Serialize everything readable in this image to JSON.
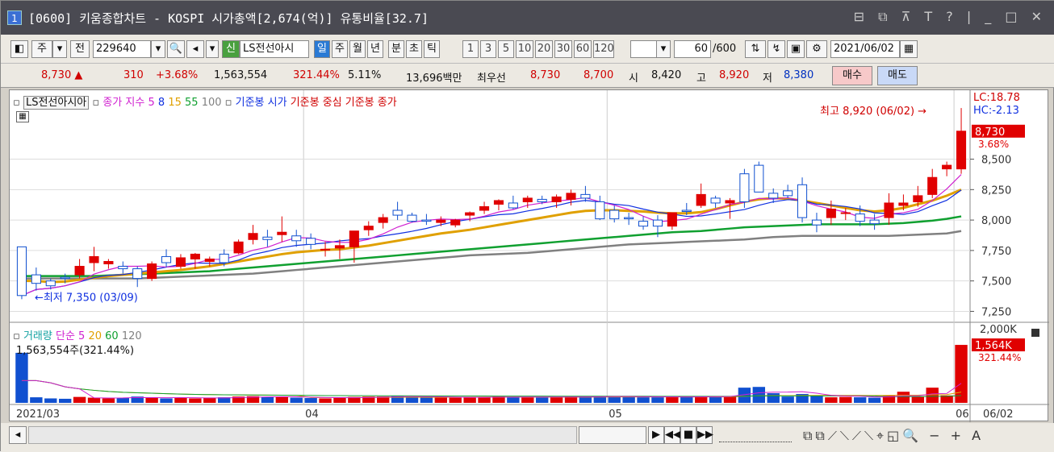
{
  "titlebar": {
    "window_num": "1",
    "title": "[0600] 키움종합차트 - KOSPI 시가총액[2,674(억)] 유통비율[32.7]"
  },
  "toolbar": {
    "market_label": "주",
    "prev_label": "전",
    "code_value": "229640",
    "credit_label": "신",
    "stock_name": "LS전선아시",
    "periods": [
      "일",
      "주",
      "월",
      "년",
      "분",
      "초",
      "틱"
    ],
    "active_period": "일",
    "intervals": [
      "1",
      "3",
      "5",
      "10",
      "20",
      "30",
      "60",
      "120"
    ],
    "count_value": "60",
    "count_total": "/600",
    "date_value": "2021/06/02"
  },
  "quote": {
    "price": "8,730 ▲",
    "change": "310",
    "change_pct": "+3.68%",
    "volume": "1,563,554",
    "volume_pct": "321.44%",
    "turnover": "5.11%",
    "amount": "13,696백만",
    "best_label": "최우선",
    "ask": "8,730",
    "bid": "8,700",
    "open_label": "시",
    "open": "8,420",
    "high_label": "고",
    "high": "8,920",
    "low_label": "저",
    "low": "8,380",
    "buy_label": "매수",
    "sell_label": "매도"
  },
  "price_legend": {
    "name": "LS전선아시아",
    "ma_label": "종가 지수",
    "ma_periods": [
      "5",
      "8",
      "15",
      "55",
      "100"
    ],
    "ma_colors": [
      "#d020d0",
      "#1030e0",
      "#e0a000",
      "#10a030",
      "#808080"
    ],
    "base_open": "기준봉 시가",
    "base_mid": "기준봉 중심",
    "base_close": "기준봉 종가",
    "lc": "LC:18.78",
    "hc": "HC:-2.13"
  },
  "annotations": {
    "high_note": "최고 8,920 (06/02) →",
    "low_note": "←최저 7,350 (03/09)",
    "last_price": "8,730",
    "last_pct": "3.68%"
  },
  "volume_legend": {
    "label": "거래량",
    "ma_label": "단순",
    "ma_periods": [
      "5",
      "20",
      "60",
      "120"
    ],
    "value_text": "1,563,554주(321.44%)",
    "axis_top": "2,000K",
    "last_value": "1,564K",
    "last_pct": "321.44%"
  },
  "x_axis": {
    "labels": [
      "2021/03",
      "04",
      "05",
      "06"
    ],
    "cursor_date": "06/02"
  },
  "chart_data": {
    "type": "candlestick",
    "y_ticks": [
      "8,500",
      "8,250",
      "8,000",
      "7,750",
      "7,500",
      "7,250"
    ],
    "ylim": [
      7200,
      9000
    ],
    "candles": [
      [
        7780,
        7780,
        7350,
        7380
      ],
      [
        7550,
        7610,
        7420,
        7480
      ],
      [
        7500,
        7520,
        7430,
        7460
      ],
      [
        7530,
        7560,
        7480,
        7520
      ],
      [
        7550,
        7680,
        7520,
        7620
      ],
      [
        7650,
        7780,
        7580,
        7700
      ],
      [
        7640,
        7680,
        7600,
        7660
      ],
      [
        7620,
        7660,
        7560,
        7600
      ],
      [
        7600,
        7620,
        7450,
        7520
      ],
      [
        7520,
        7660,
        7500,
        7640
      ],
      [
        7700,
        7760,
        7610,
        7650
      ],
      [
        7620,
        7720,
        7600,
        7690
      ],
      [
        7680,
        7730,
        7600,
        7720
      ],
      [
        7660,
        7700,
        7620,
        7680
      ],
      [
        7720,
        7760,
        7620,
        7650
      ],
      [
        7730,
        7840,
        7720,
        7820
      ],
      [
        7840,
        7960,
        7800,
        7890
      ],
      [
        7860,
        7920,
        7780,
        7840
      ],
      [
        7880,
        8030,
        7820,
        7900
      ],
      [
        7870,
        7920,
        7780,
        7830
      ],
      [
        7850,
        7890,
        7760,
        7800
      ],
      [
        7760,
        7820,
        7700,
        7760
      ],
      [
        7770,
        7840,
        7680,
        7790
      ],
      [
        7780,
        7880,
        7650,
        7910
      ],
      [
        7920,
        7990,
        7870,
        7950
      ],
      [
        7980,
        8050,
        7930,
        8020
      ],
      [
        8080,
        8150,
        8000,
        8040
      ],
      [
        8040,
        8060,
        7980,
        7990
      ],
      [
        8000,
        8050,
        7960,
        7990
      ],
      [
        7980,
        8030,
        7950,
        8000
      ],
      [
        7960,
        8010,
        7940,
        8000
      ],
      [
        8040,
        8070,
        7990,
        8060
      ],
      [
        8080,
        8150,
        8050,
        8110
      ],
      [
        8130,
        8170,
        8080,
        8160
      ],
      [
        8140,
        8200,
        8090,
        8100
      ],
      [
        8150,
        8200,
        8100,
        8180
      ],
      [
        8170,
        8200,
        8130,
        8150
      ],
      [
        8150,
        8210,
        8100,
        8190
      ],
      [
        8170,
        8250,
        8120,
        8220
      ],
      [
        8210,
        8280,
        8150,
        8180
      ],
      [
        8150,
        8200,
        8000,
        8010
      ],
      [
        8080,
        8120,
        7980,
        8010
      ],
      [
        8020,
        8060,
        7960,
        8010
      ],
      [
        7990,
        8030,
        7920,
        7950
      ],
      [
        8000,
        8040,
        7860,
        7950
      ],
      [
        7950,
        8060,
        7920,
        8060
      ],
      [
        8080,
        8140,
        8040,
        8070
      ],
      [
        8120,
        8300,
        8100,
        8210
      ],
      [
        8180,
        8200,
        8100,
        8140
      ],
      [
        8140,
        8180,
        8010,
        8160
      ],
      [
        8380,
        8420,
        8100,
        8150
      ],
      [
        8450,
        8480,
        8250,
        8230
      ],
      [
        8220,
        8260,
        8140,
        8180
      ],
      [
        8240,
        8290,
        8180,
        8200
      ],
      [
        8290,
        8350,
        7980,
        8020
      ],
      [
        8000,
        8060,
        7900,
        7960
      ],
      [
        8020,
        8160,
        7960,
        8090
      ],
      [
        8060,
        8100,
        8000,
        8060
      ],
      [
        8050,
        8120,
        7950,
        7990
      ],
      [
        8000,
        8050,
        7920,
        7970
      ],
      [
        8020,
        8220,
        7960,
        8140
      ],
      [
        8120,
        8210,
        8080,
        8140
      ],
      [
        8150,
        8280,
        8110,
        8200
      ],
      [
        8210,
        8420,
        8180,
        8350
      ],
      [
        8420,
        8480,
        8360,
        8450
      ],
      [
        8420,
        8920,
        8380,
        8730
      ]
    ],
    "ma15": [
      7500,
      7500,
      7490,
      7495,
      7510,
      7525,
      7540,
      7550,
      7560,
      7570,
      7580,
      7590,
      7605,
      7620,
      7640,
      7660,
      7680,
      7700,
      7720,
      7735,
      7745,
      7755,
      7760,
      7775,
      7790,
      7810,
      7830,
      7850,
      7870,
      7890,
      7905,
      7920,
      7940,
      7960,
      7980,
      8000,
      8020,
      8040,
      8060,
      8075,
      8080,
      8080,
      8075,
      8070,
      8060,
      8055,
      8055,
      8065,
      8090,
      8120,
      8150,
      8170,
      8180,
      8175,
      8160,
      8140,
      8120,
      8100,
      8080,
      8070,
      8080,
      8100,
      8130,
      8160,
      8200,
      8250
    ],
    "ma55": [
      7540,
      7540,
      7540,
      7540,
      7540,
      7540,
      7545,
      7550,
      7555,
      7560,
      7565,
      7570,
      7575,
      7580,
      7590,
      7600,
      7610,
      7620,
      7630,
      7640,
      7650,
      7660,
      7670,
      7680,
      7690,
      7700,
      7710,
      7720,
      7730,
      7740,
      7750,
      7760,
      7770,
      7780,
      7790,
      7800,
      7810,
      7820,
      7830,
      7840,
      7850,
      7860,
      7870,
      7880,
      7890,
      7900,
      7905,
      7910,
      7920,
      7930,
      7940,
      7945,
      7950,
      7955,
      7960,
      7965,
      7965,
      7965,
      7965,
      7965,
      7970,
      7975,
      7985,
      7995,
      8010,
      8030
    ],
    "ma100": [
      7520,
      7520,
      7520,
      7520,
      7520,
      7520,
      7520,
      7520,
      7520,
      7525,
      7530,
      7535,
      7540,
      7545,
      7550,
      7555,
      7560,
      7570,
      7580,
      7590,
      7600,
      7610,
      7620,
      7630,
      7640,
      7650,
      7660,
      7670,
      7680,
      7690,
      7700,
      7710,
      7715,
      7720,
      7725,
      7730,
      7740,
      7750,
      7760,
      7770,
      7780,
      7790,
      7800,
      7805,
      7810,
      7815,
      7820,
      7825,
      7830,
      7835,
      7840,
      7850,
      7860,
      7865,
      7870,
      7870,
      7870,
      7870,
      7870,
      7870,
      7870,
      7875,
      7880,
      7885,
      7890,
      7910
    ],
    "volumes": [
      1350,
      150,
      120,
      110,
      160,
      140,
      120,
      130,
      170,
      150,
      120,
      130,
      120,
      140,
      150,
      170,
      180,
      160,
      170,
      140,
      130,
      120,
      140,
      160,
      170,
      170,
      180,
      160,
      150,
      150,
      140,
      150,
      160,
      170,
      160,
      150,
      150,
      160,
      170,
      170,
      170,
      180,
      160,
      150,
      150,
      170,
      170,
      180,
      160,
      180,
      410,
      430,
      260,
      170,
      240,
      200,
      150,
      160,
      150,
      140,
      200,
      300,
      160,
      410,
      200,
      1564
    ],
    "vol_ylim": [
      0,
      2000
    ]
  }
}
